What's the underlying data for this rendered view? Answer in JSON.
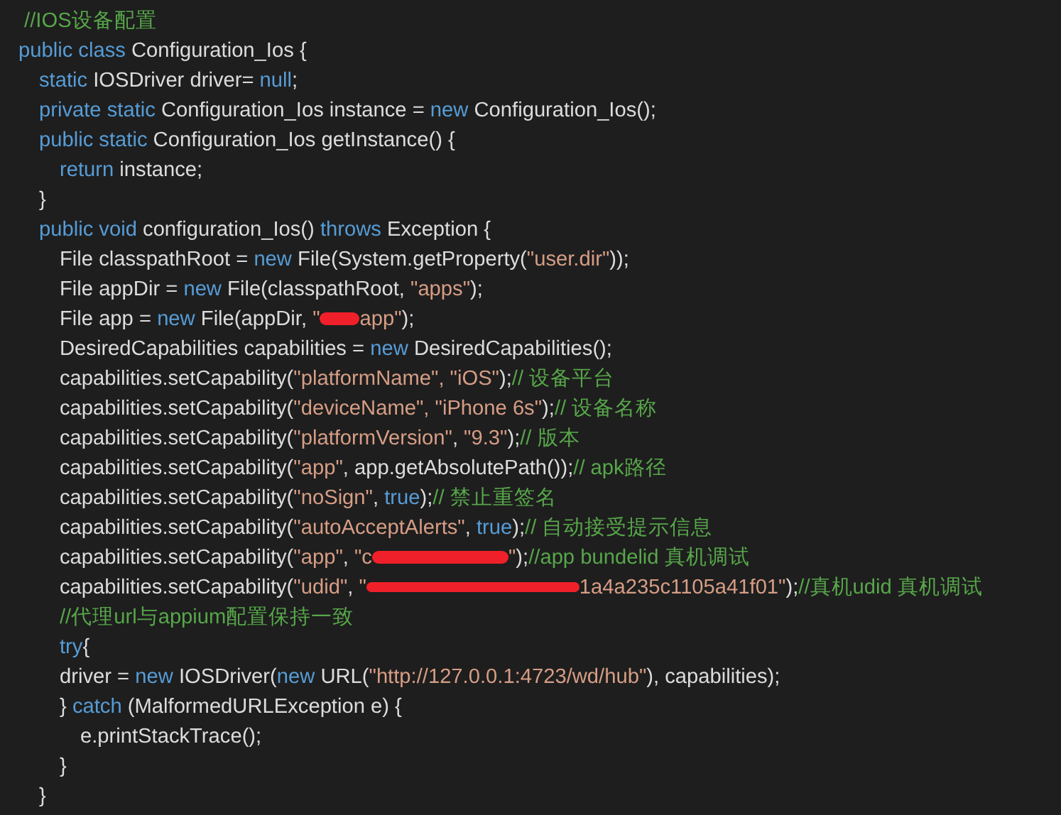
{
  "editor": {
    "lines": [
      [
        {
          "kind": "comment",
          "text": " //IOS设备配置"
        }
      ],
      [
        {
          "kind": "keyword",
          "text": "public class"
        },
        {
          "kind": "plain",
          "text": " Configuration_Ios {"
        }
      ],
      [
        {
          "kind": "keyword",
          "text": "\tstatic"
        },
        {
          "kind": "plain",
          "text": " IOSDriver driver= "
        },
        {
          "kind": "keyword",
          "text": "null"
        },
        {
          "kind": "plain",
          "text": ";"
        }
      ],
      [
        {
          "kind": "keyword",
          "text": "\tprivate static"
        },
        {
          "kind": "plain",
          "text": " Configuration_Ios instance = "
        },
        {
          "kind": "keyword",
          "text": "new"
        },
        {
          "kind": "plain",
          "text": " Configuration_Ios();"
        }
      ],
      [
        {
          "kind": "keyword",
          "text": "\tpublic static"
        },
        {
          "kind": "plain",
          "text": " Configuration_Ios getInstance() {"
        }
      ],
      [
        {
          "kind": "keyword",
          "text": "\t\treturn"
        },
        {
          "kind": "plain",
          "text": " instance;"
        }
      ],
      [
        {
          "kind": "plain",
          "text": "\t}"
        }
      ],
      [
        {
          "kind": "keyword",
          "text": "\tpublic void"
        },
        {
          "kind": "plain",
          "text": " configuration_Ios() "
        },
        {
          "kind": "keyword",
          "text": "throws"
        },
        {
          "kind": "plain",
          "text": " Exception {"
        }
      ],
      [
        {
          "kind": "plain",
          "text": "\t\tFile classpathRoot = "
        },
        {
          "kind": "keyword",
          "text": "new"
        },
        {
          "kind": "plain",
          "text": " File(System.getProperty("
        },
        {
          "kind": "string",
          "text": "\"user.dir\""
        },
        {
          "kind": "plain",
          "text": "));"
        }
      ],
      [
        {
          "kind": "plain",
          "text": "\t\tFile appDir = "
        },
        {
          "kind": "keyword",
          "text": "new"
        },
        {
          "kind": "plain",
          "text": " File(classpathRoot, "
        },
        {
          "kind": "string",
          "text": "\"apps\""
        },
        {
          "kind": "plain",
          "text": ");"
        }
      ],
      [
        {
          "kind": "plain",
          "text": "\t\tFile app = "
        },
        {
          "kind": "keyword",
          "text": "new"
        },
        {
          "kind": "plain",
          "text": " File(appDir, "
        },
        {
          "kind": "string",
          "text": "\""
        },
        {
          "kind": "redaction"
        },
        {
          "kind": "string",
          "text": "app\""
        },
        {
          "kind": "plain",
          "text": ");"
        }
      ],
      [
        {
          "kind": "plain",
          "text": "\t\tDesiredCapabilities capabilities = "
        },
        {
          "kind": "keyword",
          "text": "new"
        },
        {
          "kind": "plain",
          "text": " DesiredCapabilities();"
        }
      ],
      [
        {
          "kind": "plain",
          "text": "\t\tcapabilities.setCapability("
        },
        {
          "kind": "string",
          "text": "\"platformName\""
        },
        {
          "kind": "string",
          "text": ", \"iOS\""
        },
        {
          "kind": "plain",
          "text": ");"
        },
        {
          "kind": "comment",
          "text": "// 设备平台"
        }
      ],
      [
        {
          "kind": "plain",
          "text": "\t\tcapabilities.setCapability("
        },
        {
          "kind": "string",
          "text": "\"deviceName\""
        },
        {
          "kind": "string",
          "text": ", \"iPhone 6s\""
        },
        {
          "kind": "plain",
          "text": ");"
        },
        {
          "kind": "comment",
          "text": "// 设备名称"
        }
      ],
      [
        {
          "kind": "plain",
          "text": "\t\tcapabilities.setCapability("
        },
        {
          "kind": "string",
          "text": "\"platformVersion\""
        },
        {
          "kind": "plain",
          "text": ", "
        },
        {
          "kind": "string",
          "text": "\"9.3\""
        },
        {
          "kind": "plain",
          "text": ");"
        },
        {
          "kind": "comment",
          "text": "// 版本"
        }
      ],
      [
        {
          "kind": "plain",
          "text": "\t\tcapabilities.setCapability("
        },
        {
          "kind": "string",
          "text": "\"app\""
        },
        {
          "kind": "plain",
          "text": ", app.getAbsolutePath());"
        },
        {
          "kind": "comment",
          "text": "// apk路径"
        }
      ],
      [
        {
          "kind": "plain",
          "text": "\t\tcapabilities.setCapability("
        },
        {
          "kind": "string",
          "text": "\"noSign\""
        },
        {
          "kind": "plain",
          "text": ", "
        },
        {
          "kind": "keyword",
          "text": "true"
        },
        {
          "kind": "plain",
          "text": ");"
        },
        {
          "kind": "comment",
          "text": "// 禁止重签名"
        }
      ],
      [
        {
          "kind": "plain",
          "text": "\t\tcapabilities.setCapability("
        },
        {
          "kind": "string",
          "text": "\"autoAcceptAlerts\""
        },
        {
          "kind": "plain",
          "text": ", "
        },
        {
          "kind": "keyword",
          "text": "true"
        },
        {
          "kind": "plain",
          "text": ");"
        },
        {
          "kind": "comment",
          "text": "// 自动接受提示信息"
        }
      ],
      [
        {
          "kind": "plain",
          "text": "\t\tcapabilities.setCapability("
        },
        {
          "kind": "string",
          "text": "\"app\""
        },
        {
          "kind": "plain",
          "text": ", "
        },
        {
          "kind": "string",
          "text": "\"c"
        },
        {
          "kind": "redaction"
        },
        {
          "kind": "string",
          "text": "\""
        },
        {
          "kind": "plain",
          "text": ");"
        },
        {
          "kind": "comment",
          "text": "//app bundelid 真机调试"
        }
      ],
      [
        {
          "kind": "plain",
          "text": "\t\tcapabilities.setCapability("
        },
        {
          "kind": "string",
          "text": "\"udid\""
        },
        {
          "kind": "plain",
          "text": ", "
        },
        {
          "kind": "string",
          "text": "\""
        },
        {
          "kind": "redaction"
        },
        {
          "kind": "string",
          "text": "1a4a235c1105a41f01\""
        },
        {
          "kind": "plain",
          "text": ");"
        },
        {
          "kind": "comment",
          "text": "//真机udid 真机调试"
        }
      ],
      [
        {
          "kind": "comment",
          "text": "\t\t//代理url与appium配置保持一致"
        }
      ],
      [
        {
          "kind": "keyword",
          "text": "\t\ttry"
        },
        {
          "kind": "plain",
          "text": "{"
        }
      ],
      [
        {
          "kind": "plain",
          "text": "\t\tdriver = "
        },
        {
          "kind": "keyword",
          "text": "new"
        },
        {
          "kind": "plain",
          "text": " IOSDriver("
        },
        {
          "kind": "keyword",
          "text": "new"
        },
        {
          "kind": "plain",
          "text": " URL("
        },
        {
          "kind": "string",
          "text": "\"http://127.0.0.1:4723/wd/hub\""
        },
        {
          "kind": "plain",
          "text": "), capabilities);"
        }
      ],
      [
        {
          "kind": "plain",
          "text": "\t\t} "
        },
        {
          "kind": "keyword",
          "text": "catch"
        },
        {
          "kind": "plain",
          "text": " (MalformedURLException e) {"
        }
      ],
      [
        {
          "kind": "plain",
          "text": "\t\t\te.printStackTrace();"
        }
      ],
      [
        {
          "kind": "plain",
          "text": "\t\t}"
        }
      ],
      [
        {
          "kind": "plain",
          "text": "\t}"
        }
      ]
    ]
  }
}
